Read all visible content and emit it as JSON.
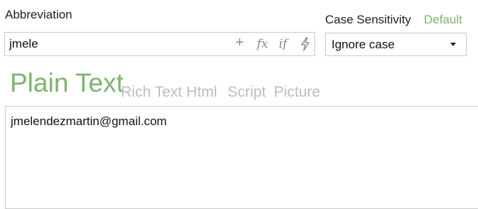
{
  "abbreviation": {
    "label": "Abbreviation",
    "value": "jmele",
    "tools": {
      "insert": "+",
      "function": "fx",
      "condition": "if",
      "action_icon": "lightning-icon"
    }
  },
  "case_sensitivity": {
    "label": "Case Sensitivity",
    "default_link": "Default",
    "selected": "Ignore case"
  },
  "tabs": [
    {
      "label": "Plain Text",
      "active": true
    },
    {
      "label": "Rich Text",
      "active": false
    },
    {
      "label": "Html",
      "active": false
    },
    {
      "label": "Script",
      "active": false
    },
    {
      "label": "Picture",
      "active": false
    }
  ],
  "content": {
    "text": "jmelendezmartin@gmail.com"
  },
  "colors": {
    "accent": "#7fb36f",
    "inactive_tab": "#bdbdbd",
    "border": "#c9c9c9"
  }
}
